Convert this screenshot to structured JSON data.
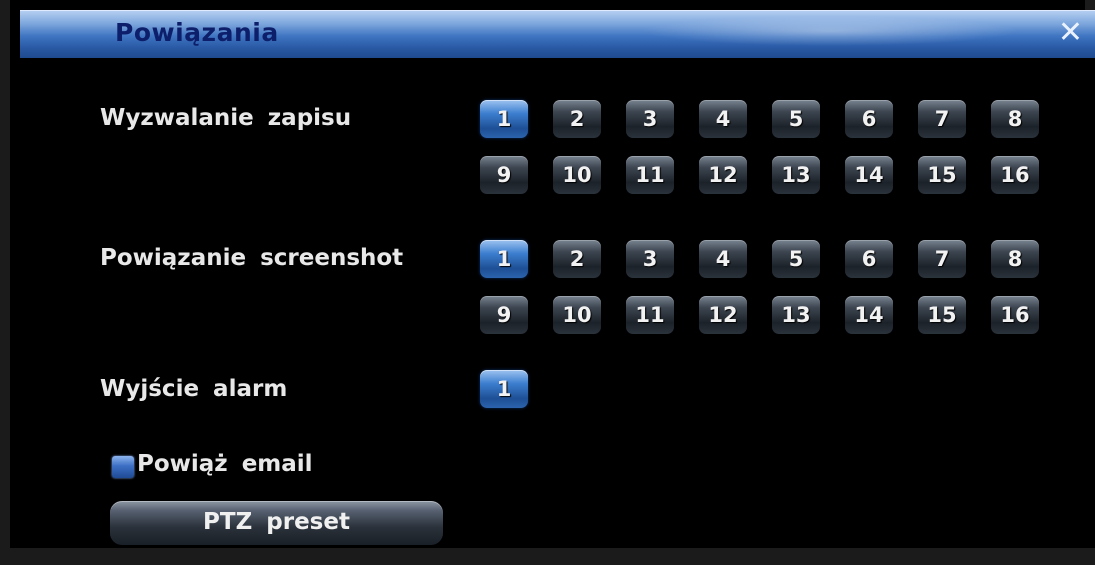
{
  "window": {
    "title": "Powiązania",
    "close_glyph": "✕"
  },
  "record_trigger": {
    "label": "Wyzwalanie zapisu",
    "channels": [
      "1",
      "2",
      "3",
      "4",
      "5",
      "6",
      "7",
      "8",
      "9",
      "10",
      "11",
      "12",
      "13",
      "14",
      "15",
      "16"
    ],
    "selected": [
      "1"
    ]
  },
  "screenshot_link": {
    "label": "Powiązanie screenshot",
    "channels": [
      "1",
      "2",
      "3",
      "4",
      "5",
      "6",
      "7",
      "8",
      "9",
      "10",
      "11",
      "12",
      "13",
      "14",
      "15",
      "16"
    ],
    "selected": [
      "1"
    ]
  },
  "alarm_output": {
    "label": "Wyjście alarm",
    "channels": [
      "1"
    ],
    "selected": [
      "1"
    ]
  },
  "email_link": {
    "label": "Powiąż email",
    "checked": true
  },
  "ptz_button": {
    "label": "PTZ preset"
  },
  "colors": {
    "title_bar": "#3e74c1",
    "title_text": "#0d1f6a",
    "selected_button": "#3d7fd0",
    "unselected_button": "#3d4651"
  }
}
